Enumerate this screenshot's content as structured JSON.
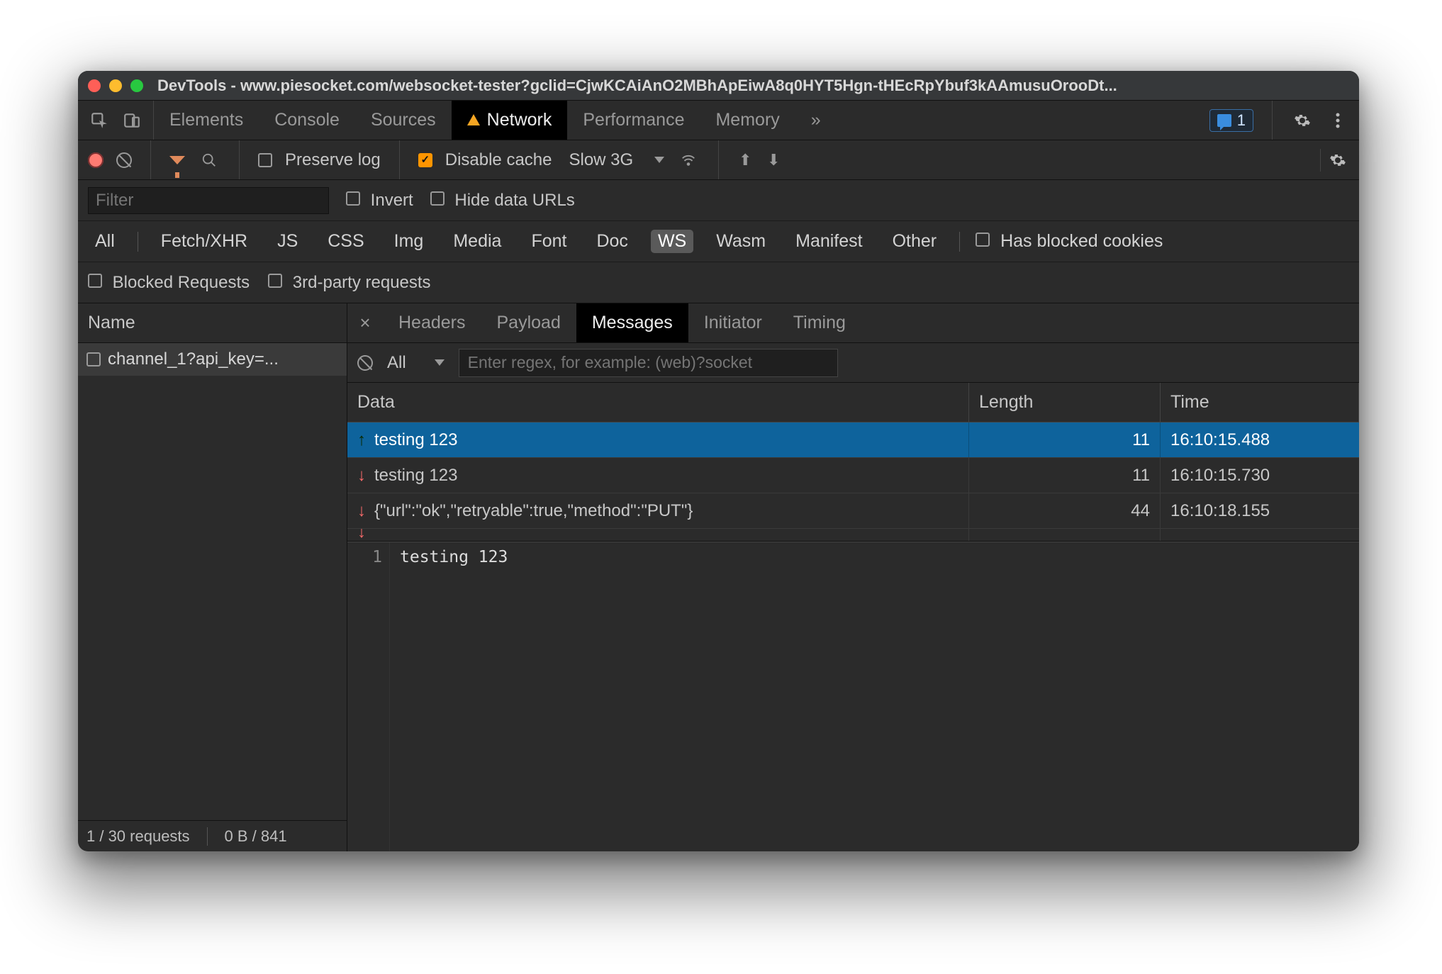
{
  "titlebar": {
    "title": "DevTools - www.piesocket.com/websocket-tester?gclid=CjwKCAiAnO2MBhApEiwA8q0HYT5Hgn-tHEcRpYbuf3kAAmusuOrooDt..."
  },
  "mainTabs": {
    "items": [
      "Elements",
      "Console",
      "Sources",
      "Network",
      "Performance",
      "Memory"
    ],
    "more": "»",
    "active": "Network",
    "issuesCount": "1"
  },
  "toolbar": {
    "preserveLog": "Preserve log",
    "disableCache": "Disable cache",
    "throttling": "Slow 3G"
  },
  "filterRow": {
    "placeholder": "Filter",
    "invert": "Invert",
    "hideDataUrls": "Hide data URLs"
  },
  "types": {
    "items": [
      "All",
      "Fetch/XHR",
      "JS",
      "CSS",
      "Img",
      "Media",
      "Font",
      "Doc",
      "WS",
      "Wasm",
      "Manifest",
      "Other"
    ],
    "active": "WS",
    "hasBlockedCookies": "Has blocked cookies"
  },
  "blocked": {
    "blockedRequests": "Blocked Requests",
    "thirdParty": "3rd-party requests"
  },
  "requests": {
    "nameHeader": "Name",
    "items": [
      {
        "label": "channel_1?api_key=..."
      }
    ],
    "status": {
      "count": "1 / 30 requests",
      "bytes": "0 B / 841"
    }
  },
  "detailTabs": {
    "items": [
      "Headers",
      "Payload",
      "Messages",
      "Initiator",
      "Timing"
    ],
    "active": "Messages"
  },
  "messages": {
    "filterAll": "All",
    "regexPlaceholder": "Enter regex, for example: (web)?socket",
    "headers": {
      "data": "Data",
      "length": "Length",
      "time": "Time"
    },
    "rows": [
      {
        "dir": "up",
        "data": "testing 123",
        "length": "11",
        "time": "16:10:15.488",
        "selected": true
      },
      {
        "dir": "down",
        "data": "testing 123",
        "length": "11",
        "time": "16:10:15.730",
        "selected": false
      },
      {
        "dir": "down",
        "data": "{\"url\":\"ok\",\"retryable\":true,\"method\":\"PUT\"}",
        "length": "44",
        "time": "16:10:18.155",
        "selected": false
      }
    ],
    "viewer": {
      "lineNo": "1",
      "content": "testing 123"
    }
  }
}
